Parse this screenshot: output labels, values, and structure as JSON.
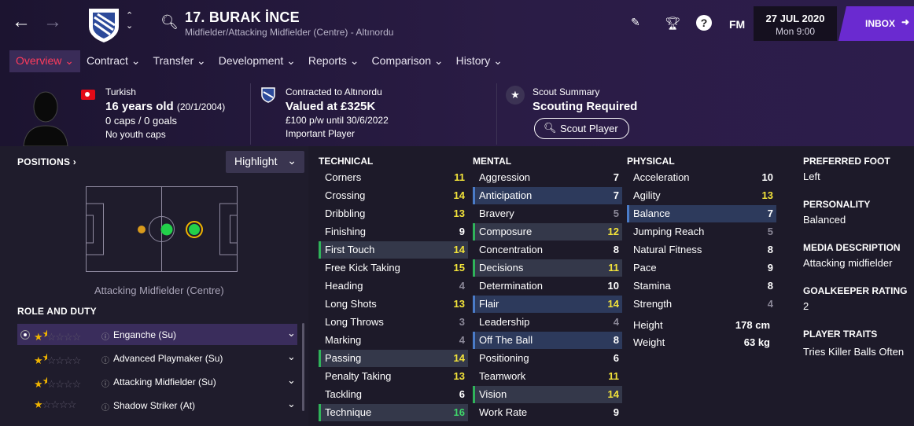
{
  "header": {
    "player_name": "17. BURAK İNCE",
    "positions": "Midfielder/Attacking Midfielder (Centre) - Altınordu",
    "date": "27 JUL 2020",
    "time": "Mon 9:00",
    "inbox": "INBOX",
    "fm": "FM"
  },
  "menu": [
    {
      "label": "Overview"
    },
    {
      "label": "Contract"
    },
    {
      "label": "Transfer"
    },
    {
      "label": "Development"
    },
    {
      "label": "Reports"
    },
    {
      "label": "Comparison"
    },
    {
      "label": "History"
    }
  ],
  "bio": {
    "nationality": "Turkish",
    "age": "16 years old",
    "dob": "(20/1/2004)",
    "caps": "0 caps / 0 goals",
    "youth": "No youth caps"
  },
  "contract": {
    "club": "Contracted to Altınordu",
    "value": "Valued at £325K",
    "wage": "£100 p/w until 30/6/2022",
    "status": "Important Player"
  },
  "scout": {
    "label": "Scout Summary",
    "status": "Scouting Required",
    "button": "Scout Player"
  },
  "positions": {
    "title": "POSITIONS",
    "highlight": "Highlight",
    "position_name": "Attacking Midfielder (Centre)"
  },
  "roles": {
    "title": "ROLE AND DUTY",
    "items": [
      {
        "name": "Enganche (Su)",
        "stars": 1.5
      },
      {
        "name": "Advanced Playmaker (Su)",
        "stars": 1.5
      },
      {
        "name": "Attacking Midfielder (Su)",
        "stars": 1.5
      },
      {
        "name": "Shadow Striker (At)",
        "stars": 1
      }
    ]
  },
  "attributes": {
    "technical": {
      "title": "TECHNICAL",
      "rows": [
        [
          "Corners",
          "11"
        ],
        [
          "Crossing",
          "14"
        ],
        [
          "Dribbling",
          "13"
        ],
        [
          "Finishing",
          "9"
        ],
        [
          "First Touch",
          "14"
        ],
        [
          "Free Kick Taking",
          "15"
        ],
        [
          "Heading",
          "4"
        ],
        [
          "Long Shots",
          "13"
        ],
        [
          "Long Throws",
          "3"
        ],
        [
          "Marking",
          "4"
        ],
        [
          "Passing",
          "14"
        ],
        [
          "Penalty Taking",
          "13"
        ],
        [
          "Tackling",
          "6"
        ],
        [
          "Technique",
          "16"
        ]
      ]
    },
    "mental": {
      "title": "MENTAL",
      "rows": [
        [
          "Aggression",
          "7"
        ],
        [
          "Anticipation",
          "7"
        ],
        [
          "Bravery",
          "5"
        ],
        [
          "Composure",
          "12"
        ],
        [
          "Concentration",
          "8"
        ],
        [
          "Decisions",
          "11"
        ],
        [
          "Determination",
          "10"
        ],
        [
          "Flair",
          "14"
        ],
        [
          "Leadership",
          "4"
        ],
        [
          "Off The Ball",
          "8"
        ],
        [
          "Positioning",
          "6"
        ],
        [
          "Teamwork",
          "11"
        ],
        [
          "Vision",
          "14"
        ],
        [
          "Work Rate",
          "9"
        ]
      ]
    },
    "physical": {
      "title": "PHYSICAL",
      "rows": [
        [
          "Acceleration",
          "10"
        ],
        [
          "Agility",
          "13"
        ],
        [
          "Balance",
          "7"
        ],
        [
          "Jumping Reach",
          "5"
        ],
        [
          "Natural Fitness",
          "8"
        ],
        [
          "Pace",
          "9"
        ],
        [
          "Stamina",
          "8"
        ],
        [
          "Strength",
          "4"
        ]
      ]
    },
    "height_label": "Height",
    "height": "178 cm",
    "weight_label": "Weight",
    "weight": "63 kg"
  },
  "details": {
    "foot_title": "PREFERRED FOOT",
    "foot": "Left",
    "personality_title": "PERSONALITY",
    "personality": "Balanced",
    "media_title": "MEDIA DESCRIPTION",
    "media": "Attacking midfielder",
    "gk_title": "GOALKEEPER RATING",
    "gk": "2",
    "traits_title": "PLAYER TRAITS",
    "traits": "Tries Killer Balls Often"
  }
}
